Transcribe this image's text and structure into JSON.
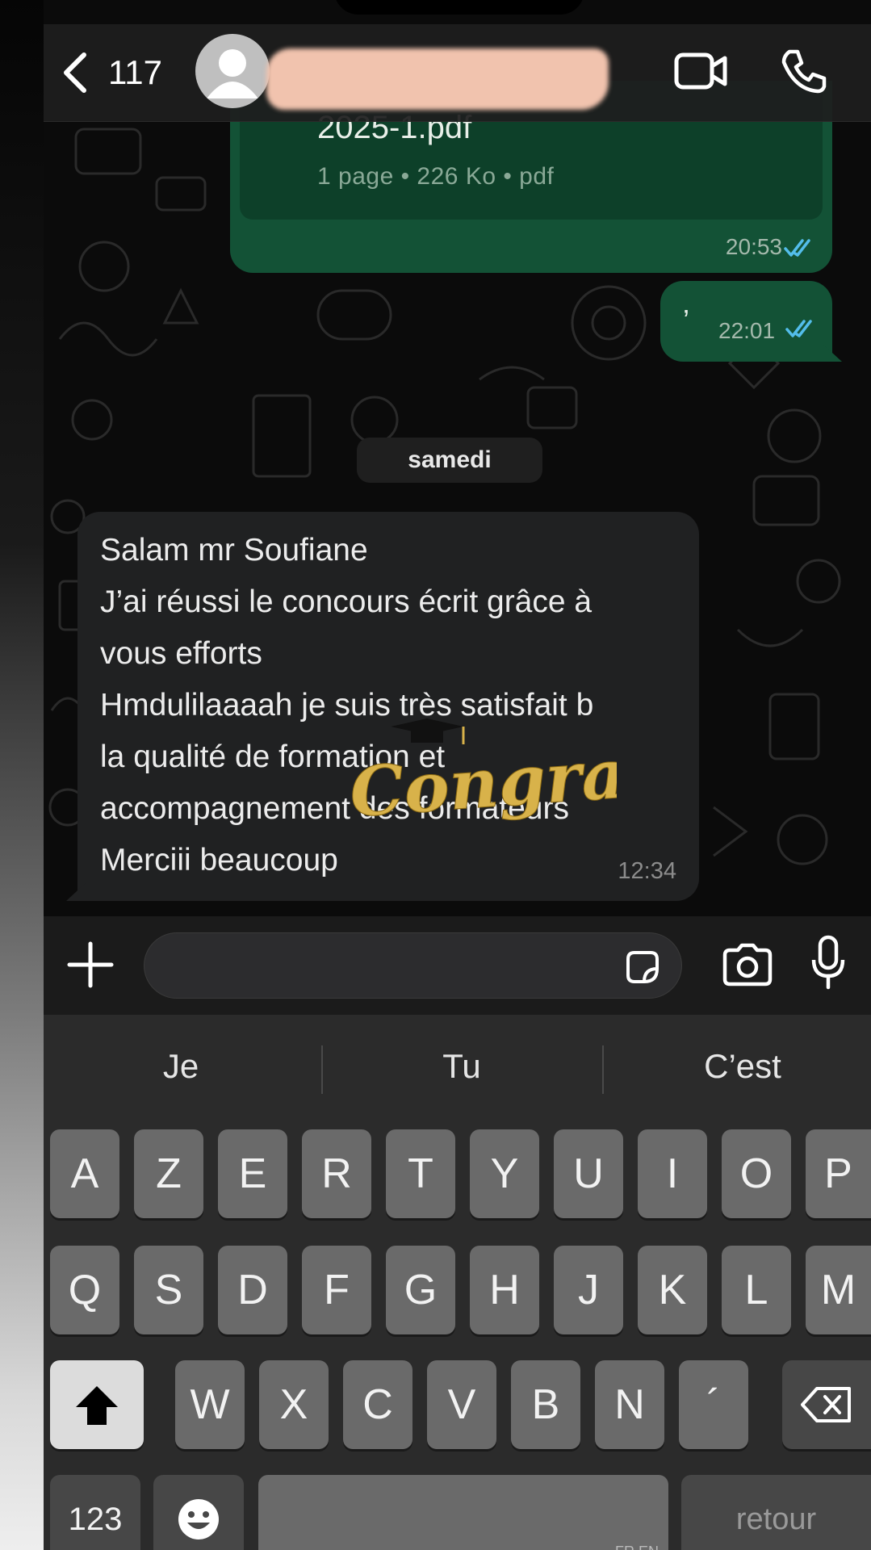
{
  "header": {
    "back_count": "117"
  },
  "messages": {
    "file": {
      "name": "2025-1.pdf",
      "meta": "1 page • 226 Ko • pdf",
      "time": "20:53"
    },
    "short": {
      "text": "’",
      "time": "22:01"
    },
    "date_separator": "samedi",
    "incoming": {
      "lines": [
        "Salam mr Soufiane",
        "J’ai réussi le concours écrit grâce à",
        "vous efforts",
        "Hmdulilaaaah je suis très satisfait b",
        "la qualité de formation et",
        "accompagnement des formateurs",
        "Merciii beaucoup"
      ],
      "time": "12:34"
    },
    "sticker_text": "Congrats!"
  },
  "keyboard": {
    "suggestions": [
      "Je",
      "Tu",
      "C’est"
    ],
    "row1": [
      "A",
      "Z",
      "E",
      "R",
      "T",
      "Y",
      "U",
      "I",
      "O",
      "P"
    ],
    "row2": [
      "Q",
      "S",
      "D",
      "F",
      "G",
      "H",
      "J",
      "K",
      "L",
      "M"
    ],
    "row3": [
      "W",
      "X",
      "C",
      "V",
      "B",
      "N",
      "´"
    ],
    "numbers_label": "123",
    "return_label": "retour",
    "space_hint": "FR EN"
  },
  "colors": {
    "outgoing_bubble": "#135236",
    "incoming_bubble": "#202122",
    "read_ticks": "#53bdeb",
    "sticker_gold": "#d8b24a"
  },
  "icons": [
    "chevron-left-icon",
    "avatar-icon",
    "video-call-icon",
    "phone-icon",
    "plus-icon",
    "sticker-icon",
    "camera-icon",
    "microphone-icon",
    "shift-icon",
    "backspace-icon",
    "emoji-icon"
  ]
}
